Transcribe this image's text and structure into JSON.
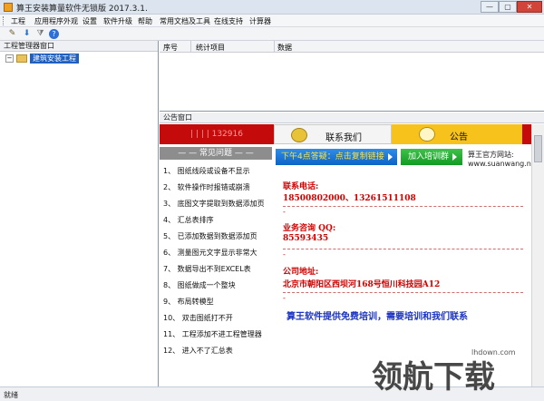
{
  "window": {
    "title": "算王安装算量软件无锁版 2017.3.1.",
    "min_label": "—",
    "max_label": "▢",
    "close_label": "✕"
  },
  "menu": [
    "工程",
    "应用程序外观",
    "设置",
    "软件升级",
    "帮助",
    "常用文档及工具",
    "在线支持",
    "计算器"
  ],
  "toolbar": {
    "icons": [
      "tools-icon",
      "download-icon",
      "filter-icon",
      "help-icon"
    ]
  },
  "left_panel": {
    "header": "工程管理器窗口",
    "tree_item": "建筑安装工程"
  },
  "grid": {
    "columns": [
      "序号",
      "统计项目",
      "数据"
    ]
  },
  "notice_panel": {
    "header": "公告窗口",
    "tab_red_text": "| |  | |  132916",
    "tab_contact": "联系我们",
    "tab_notice": "公告",
    "faq_header": "— —  常见问题  — —",
    "faq": [
      "1、 图纸线段或设备不显示",
      "2、 软件操作时报错或崩溃",
      "3、 底图文字提取到数据添加页",
      "4、 汇总表排序",
      "5、 已添加数据到数据添加页",
      "6、 测量图元文字显示非常大",
      "7、 数据导出不到EXCEL表",
      "8、 图纸做成一个整块",
      "9、 布局转模型",
      "10、 双击图纸打不开",
      "11、 工程添加不进工程管理器",
      "12、 进入不了汇总表"
    ],
    "promo_qq": "下午4点答疑：点击复制链接",
    "promo_join": "加入培训群",
    "official_label": "算王官方网站:",
    "official_url": "www.suanwang.net",
    "phone_label": "联系电话:",
    "phone_value": "18500802000、13261511108",
    "qq_label": "业务咨询 QQ:",
    "qq_value": "85593435",
    "address_label": "公司地址:",
    "address_value": "北京市朝阳区西坝河168号恒川科技园A12",
    "free_training": "算王软件提供免费培训，需要培训和我们联系",
    "dash_marker": "-"
  },
  "status": {
    "text": "就绪"
  },
  "watermark": {
    "text": "领航下载",
    "site": "lhdown.com"
  },
  "colors": {
    "accent_red": "#c40a0a",
    "notice_yellow": "#f7c21b",
    "link_blue": "#1a33c2"
  }
}
